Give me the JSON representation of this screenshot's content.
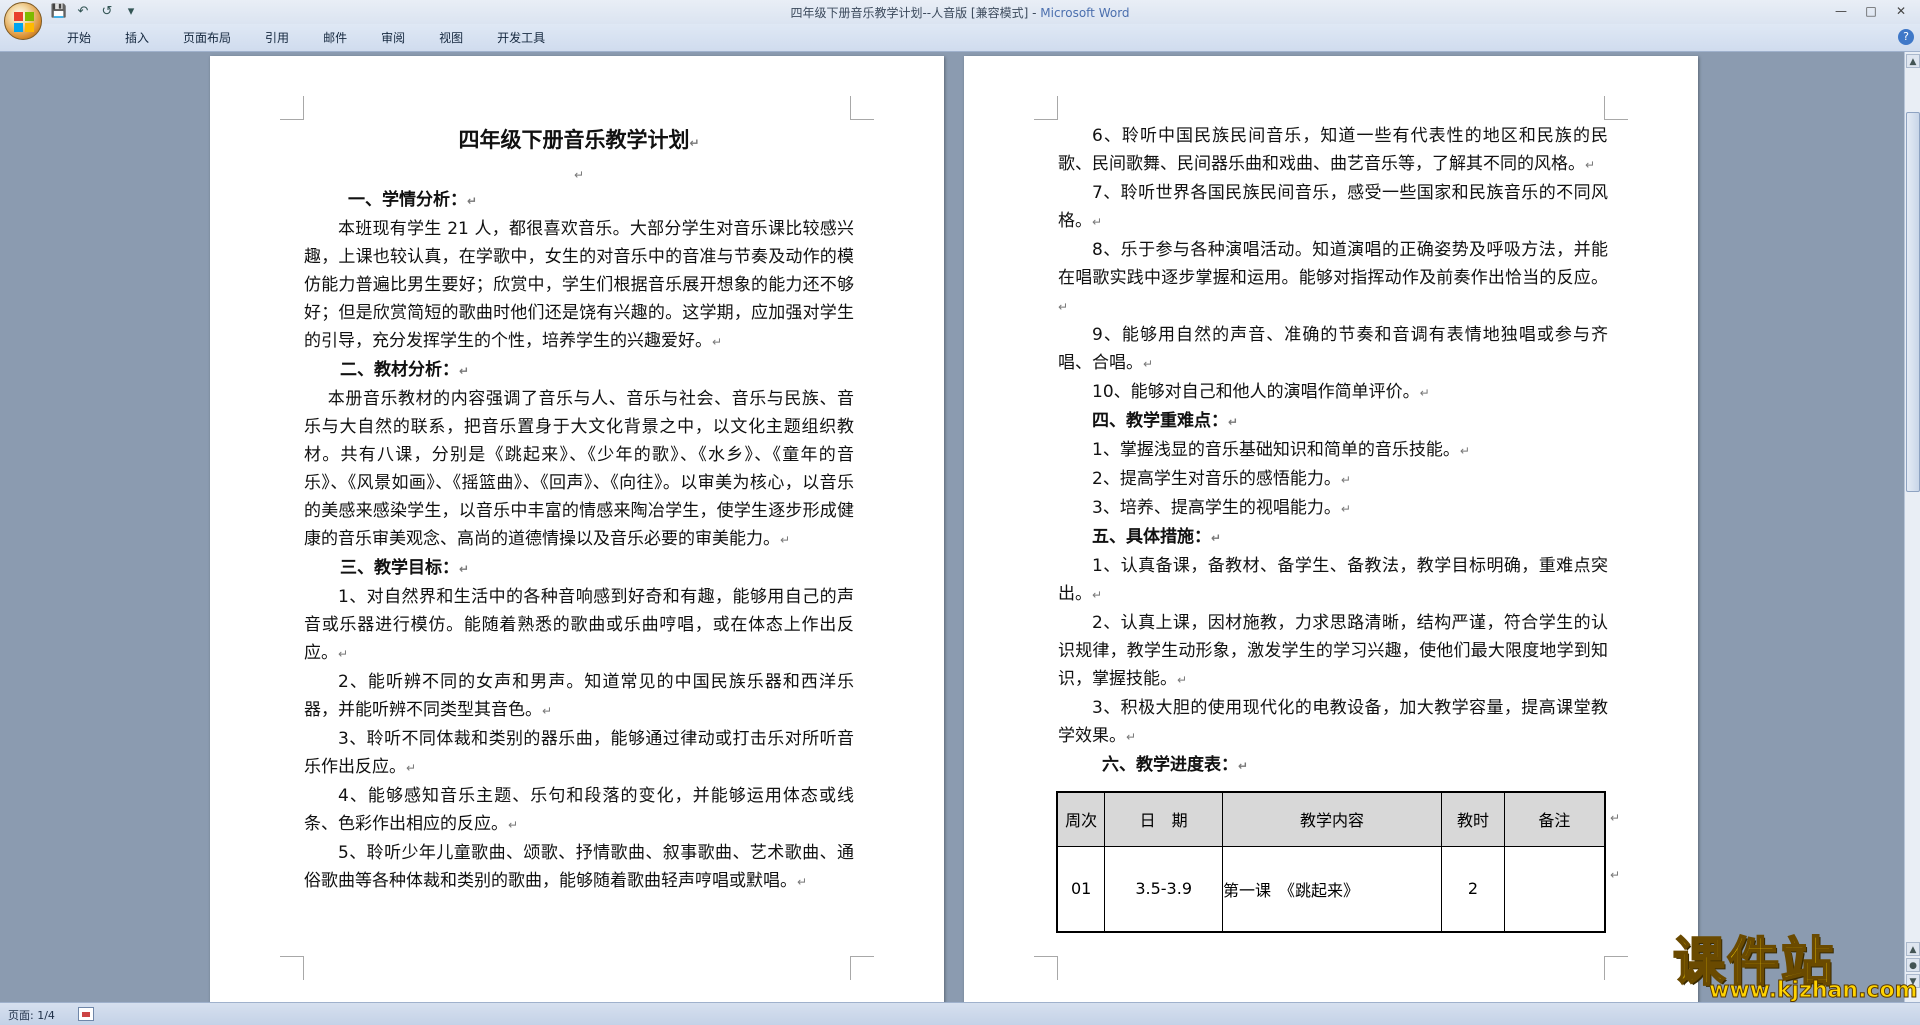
{
  "window": {
    "title": "四年级下册音乐教学计划--人音版 [兼容模式] - ",
    "brand": "Microsoft Word"
  },
  "ribbon": {
    "tabs": [
      "开始",
      "插入",
      "页面布局",
      "引用",
      "邮件",
      "审阅",
      "视图",
      "开发工具"
    ]
  },
  "status": {
    "page": "页面: 1/4"
  },
  "page1": {
    "title": "四年级下册音乐教学计划",
    "s1_head": "一、学情分析：",
    "s1_body": "本班现有学生 21 人，都很喜欢音乐。大部分学生对音乐课比较感兴趣，上课也较认真，在学歌中，女生的对音乐中的音准与节奏及动作的模仿能力普遍比男生要好；欣赏中，学生们根据音乐展开想象的能力还不够好；但是欣赏简短的歌曲时他们还是饶有兴趣的。这学期，应加强对学生的引导，充分发挥学生的个性，培养学生的兴趣爱好。",
    "s2_head": "二、教材分析：",
    "s2_body": "本册音乐教材的内容强调了音乐与人、音乐与社会、音乐与民族、音乐与大自然的联系，把音乐置身于大文化背景之中，以文化主题组织教材。共有八课，分别是《跳起来》、《少年的歌》、《水乡》、《童年的音乐》、《风景如画》、《摇篮曲》、《回声》、《向往》。以审美为核心，以音乐的美感来感染学生，以音乐中丰富的情感来陶冶学生，使学生逐步形成健康的音乐审美观念、高尚的道德情操以及音乐必要的审美能力。",
    "s3_head": "三、教学目标：",
    "g1": "1、对自然界和生活中的各种音响感到好奇和有趣，能够用自己的声音或乐器进行模仿。能随着熟悉的歌曲或乐曲哼唱，或在体态上作出反应。",
    "g2": "2、能听辨不同的女声和男声。知道常见的中国民族乐器和西洋乐器，并能听辨不同类型其音色。",
    "g3": "3、聆听不同体裁和类别的器乐曲，能够通过律动或打击乐对所听音乐作出反应。",
    "g4": "4、能够感知音乐主题、乐句和段落的变化，并能够运用体态或线条、色彩作出相应的反应。",
    "g5": "5、聆听少年儿童歌曲、颂歌、抒情歌曲、叙事歌曲、艺术歌曲、通俗歌曲等各种体裁和类别的歌曲，能够随着歌曲轻声哼唱或默唱。"
  },
  "page2": {
    "g6": "6、聆听中国民族民间音乐，知道一些有代表性的地区和民族的民歌、民间歌舞、民间器乐曲和戏曲、曲艺音乐等，了解其不同的风格。",
    "g7": "7、聆听世界各国民族民间音乐，感受一些国家和民族音乐的不同风格。",
    "g8": "8、乐于参与各种演唱活动。知道演唱的正确姿势及呼吸方法，并能在唱歌实践中逐步掌握和运用。能够对指挥动作及前奏作出恰当的反应。",
    "g9": "9、能够用自然的声音、准确的节奏和音调有表情地独唱或参与齐唱、合唱。",
    "g10": "10、能够对自己和他人的演唱作简单评价。",
    "s4_head": "四、教学重难点：",
    "k1": "1、掌握浅显的音乐基础知识和简单的音乐技能。",
    "k2": "2、提高学生对音乐的感悟能力。",
    "k3": "3、培养、提高学生的视唱能力。",
    "s5_head": "五、具体措施：",
    "m1": "1、认真备课，备教材、备学生、备教法，教学目标明确，重难点突出。",
    "m2": "2、认真上课，因材施教，力求思路清晰，结构严谨，符合学生的认识规律，教学生动形象，激发学生的学习兴趣，使他们最大限度地学到知识，掌握技能。",
    "m3": "3、积极大胆的使用现代化的电教设备，加大教学容量，提高课堂教学效果。",
    "s6_head": "六、教学进度表：",
    "table": {
      "headers": [
        "周次",
        "日　期",
        "教学内容",
        "教时",
        "备注"
      ],
      "rows": [
        [
          "01",
          "3.5-3.9",
          "第一课　《跳起来》",
          "2",
          ""
        ]
      ]
    }
  },
  "watermark": {
    "text": "课件站",
    "url": "www.kjzhan.com"
  }
}
